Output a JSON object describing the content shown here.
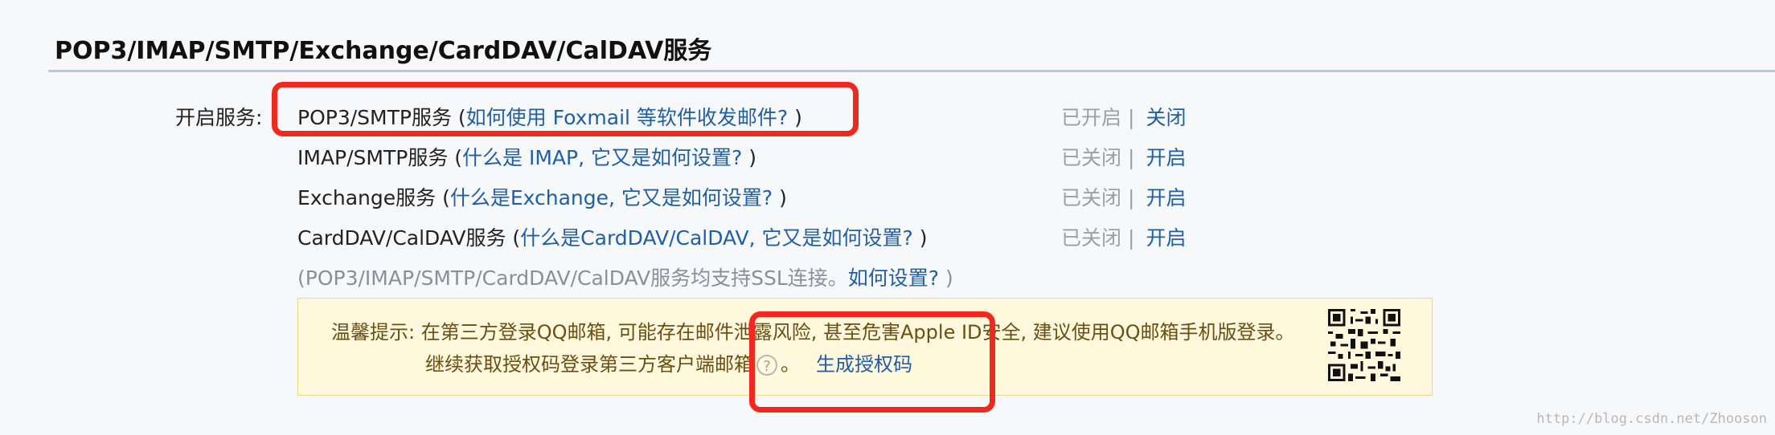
{
  "section": {
    "title": "POP3/IMAP/SMTP/Exchange/CardDAV/CalDAV服务"
  },
  "label": "开启服务:",
  "services": [
    {
      "name": "POP3/SMTP服务",
      "open": " (",
      "help": "如何使用 Foxmail 等软件收发邮件?",
      "close": " )",
      "status": "已开启",
      "sep": "|",
      "action": "关闭"
    },
    {
      "name": "IMAP/SMTP服务",
      "open": " (",
      "help": "什么是 IMAP, 它又是如何设置?",
      "close": " )",
      "status": "已关闭",
      "sep": "|",
      "action": "开启"
    },
    {
      "name": "Exchange服务",
      "open": " (",
      "help": "什么是Exchange, 它又是如何设置?",
      "close": " )",
      "status": "已关闭",
      "sep": "|",
      "action": "开启"
    },
    {
      "name": "CardDAV/CalDAV服务",
      "open": " (",
      "help": "什么是CardDAV/CalDAV, 它又是如何设置?",
      "close": " )",
      "status": "已关闭",
      "sep": "|",
      "action": "开启"
    }
  ],
  "ssl_note": {
    "text": "(POP3/IMAP/SMTP/CardDAV/CalDAV服务均支持SSL连接。",
    "link": "如何设置?",
    "close": " )"
  },
  "tip": {
    "line1": "温馨提示: 在第三方登录QQ邮箱, 可能存在邮件泄露风险, 甚至危害Apple ID安全, 建议使用QQ邮箱手机版登录。",
    "line2": "继续获取授权码登录第三方客户端邮箱",
    "help_glyph": "?",
    "period": "。",
    "generate_link": "生成授权码"
  },
  "watermark": "http://blog.csdn.net/Zhooson",
  "colors": {
    "link": "#1e5fa8",
    "highlight": "#f0281e",
    "tip_bg": "#fff8dc"
  },
  "icons": {
    "qr": "qr-code-icon",
    "help": "help-circle-icon"
  }
}
